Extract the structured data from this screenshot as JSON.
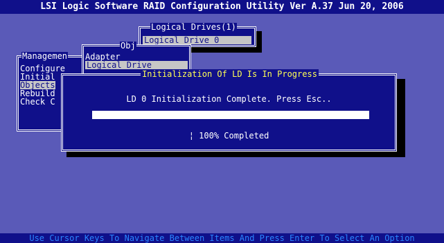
{
  "title_bar": {
    "text": "LSI Logic Software RAID Configuration Utility Ver A.37 Jun 20, 2006"
  },
  "logical_drives_menu": {
    "title": "Logical Drives(1)",
    "items": [
      {
        "label": "Logical Drive 0",
        "selected": true
      }
    ]
  },
  "objects_menu": {
    "title": "Obj",
    "items": [
      {
        "label": "Adapter",
        "selected": false
      },
      {
        "label": "Logical Drive",
        "selected": true
      }
    ]
  },
  "management_menu": {
    "title": "Managemen",
    "items": [
      {
        "label": "Configure",
        "selected": false
      },
      {
        "label": "Initial",
        "selected": false
      },
      {
        "label": "Objects",
        "selected": true
      },
      {
        "label": "Rebuild",
        "selected": false
      },
      {
        "label": "Check C",
        "selected": false
      }
    ]
  },
  "init_dialog": {
    "title": "Initialization Of LD Is In Progress",
    "message": "LD 0 Initialization Complete. Press Esc..",
    "progress": 1.0,
    "progress_text": "¦ 100% Completed"
  },
  "status_bar": {
    "text": "Use Cursor Keys To Navigate Between Items And Press Enter To Select An Option"
  },
  "colors": {
    "background": "#5a5ab8",
    "panel": "#10108a",
    "selection": "#c6c6c6",
    "status_text": "#2b86ff"
  }
}
